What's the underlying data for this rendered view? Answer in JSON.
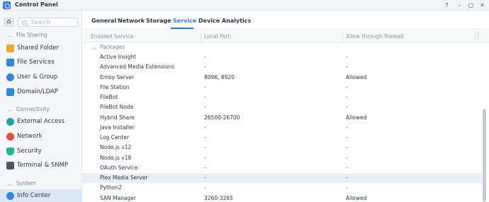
{
  "window": {
    "title": "Control Panel",
    "buttons": {
      "help": "?",
      "minimize": "–",
      "maximize": "▢",
      "close": "✕"
    }
  },
  "sidebar": {
    "search_placeholder": "Search",
    "sections": [
      {
        "label": "File Sharing",
        "items": [
          {
            "label": "Shared Folder",
            "icon": "folder-icon",
            "color": "#f5a623"
          },
          {
            "label": "File Services",
            "icon": "file-services-icon",
            "color": "#2e86de"
          },
          {
            "label": "User & Group",
            "icon": "user-group-icon",
            "color": "#2e86de"
          },
          {
            "label": "Domain/LDAP",
            "icon": "domain-icon",
            "color": "#2e86de"
          }
        ]
      },
      {
        "label": "Connectivity",
        "items": [
          {
            "label": "External Access",
            "icon": "globe-icon",
            "color": "#17a2b8"
          },
          {
            "label": "Network",
            "icon": "network-icon",
            "color": "#e74c3c"
          },
          {
            "label": "Security",
            "icon": "shield-icon",
            "color": "#17b890"
          },
          {
            "label": "Terminal & SNMP",
            "icon": "terminal-icon",
            "color": "#4a5868"
          }
        ]
      },
      {
        "label": "System",
        "items": [
          {
            "label": "Info Center",
            "icon": "info-icon",
            "color": "#2e86de",
            "active": true
          }
        ]
      }
    ]
  },
  "tabs": [
    "General",
    "Network",
    "Storage",
    "Service",
    "Device Analytics"
  ],
  "active_tab": "Service",
  "table": {
    "columns": [
      "Enabled Service",
      "Local Port",
      "Allow through firewall"
    ],
    "group": "Packages",
    "rows": [
      [
        "Active Insight",
        "-",
        "-"
      ],
      [
        "Advanced Media Extensions",
        "-",
        "-"
      ],
      [
        "Emby Server",
        "8096, 8920",
        "Allowed"
      ],
      [
        "File Station",
        "-",
        "-"
      ],
      [
        "FileBot",
        "-",
        "-"
      ],
      [
        "FileBot Node",
        "-",
        "-"
      ],
      [
        "Hybrid Share",
        "26500-26700",
        "Allowed"
      ],
      [
        "Java Installer",
        "-",
        "-"
      ],
      [
        "Log Center",
        "-",
        "-"
      ],
      [
        "Node.js v12",
        "-",
        "-"
      ],
      [
        "Node.js v18",
        "-",
        "-"
      ],
      [
        "OAuth Service",
        "-",
        "-"
      ],
      [
        "Plex Media Server",
        "-",
        "-"
      ],
      [
        "Python2",
        "-",
        "-"
      ],
      [
        "SAN Manager",
        "3260-3265",
        "Allowed"
      ]
    ],
    "selected_row": "Plex Media Server"
  }
}
